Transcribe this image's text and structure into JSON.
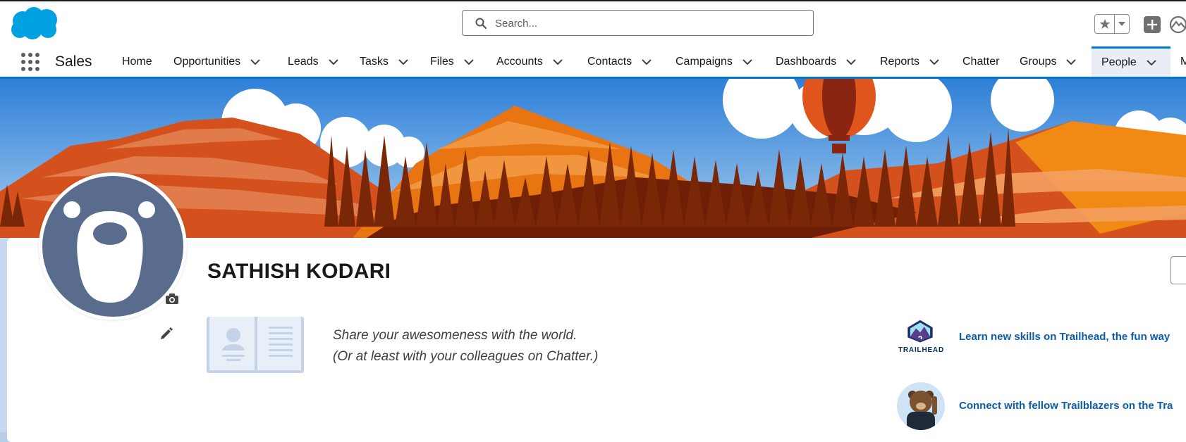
{
  "header": {
    "search_placeholder": "Search...",
    "icons": [
      "salesforce-cloud-logo",
      "search-icon",
      "star-icon",
      "caret-down-icon",
      "plus-icon",
      "trailhead-icon"
    ]
  },
  "nav": {
    "app_name": "Sales",
    "items": [
      {
        "label": "Home",
        "has_menu": false
      },
      {
        "label": "Opportunities",
        "has_menu": true
      },
      {
        "label": "Leads",
        "has_menu": true
      },
      {
        "label": "Tasks",
        "has_menu": true
      },
      {
        "label": "Files",
        "has_menu": true
      },
      {
        "label": "Accounts",
        "has_menu": true
      },
      {
        "label": "Contacts",
        "has_menu": true
      },
      {
        "label": "Campaigns",
        "has_menu": true
      },
      {
        "label": "Dashboards",
        "has_menu": true
      },
      {
        "label": "Reports",
        "has_menu": true
      },
      {
        "label": "Chatter",
        "has_menu": false
      },
      {
        "label": "Groups",
        "has_menu": true
      },
      {
        "label": "People",
        "has_menu": true,
        "active": true
      },
      {
        "label": "M",
        "has_menu": false
      }
    ]
  },
  "profile": {
    "name": "SATHISH KODARI",
    "share_line1": "Share your awesomeness with the world.",
    "share_line2": "(Or at least with your colleagues on Chatter.)"
  },
  "promos": {
    "trailhead_logo_text": "TRAILHEAD",
    "trailhead_link": "Learn new skills on Trailhead, the fun way",
    "community_link": "Connect with fellow Trailblazers on the Tra"
  },
  "colors": {
    "brand_blue": "#0176d3",
    "link_blue": "#0b5cab",
    "avatar_bg": "#5a6c8e",
    "banner_sky": "#5a9be0"
  }
}
